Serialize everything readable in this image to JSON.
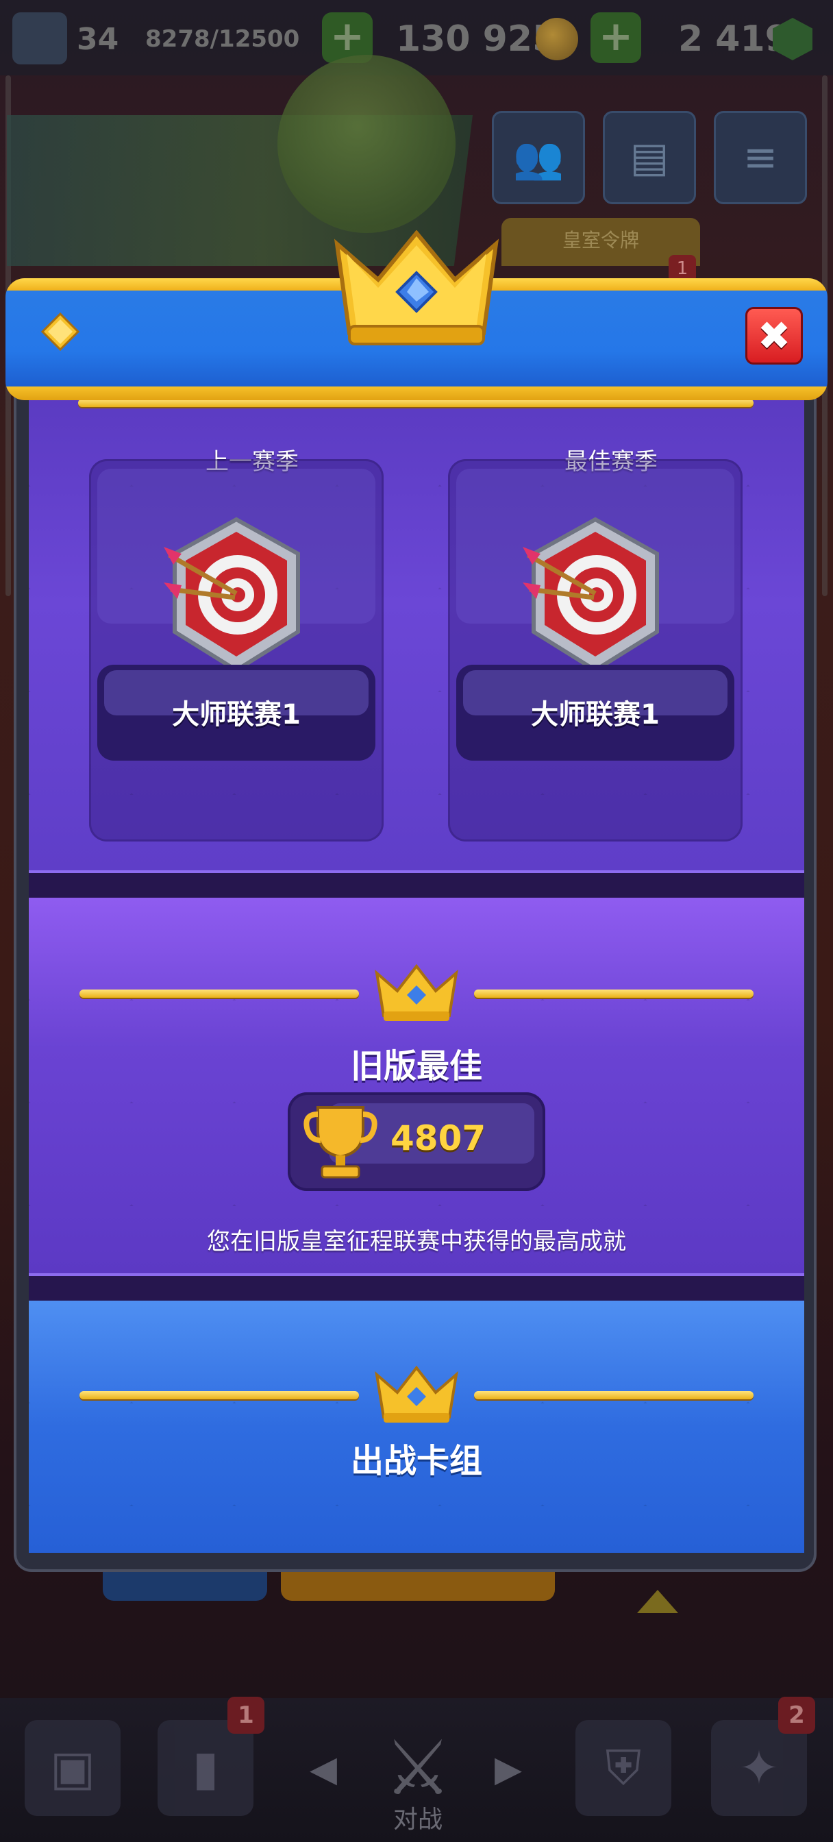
{
  "top_bar": {
    "level": "34",
    "xp": "8278/12500",
    "gold": "130 925",
    "gems": "2 419"
  },
  "background": {
    "royal_pass_tab": "皇室令牌",
    "royal_pass_badge": "1",
    "nav_cards_badge": "1",
    "nav_clan_badge": "2",
    "nav_battle_label": "对战"
  },
  "modal": {
    "close_label": "✖",
    "seasons": [
      {
        "label": "上一赛季",
        "rank": "大师联赛1"
      },
      {
        "label": "最佳赛季",
        "rank": "大师联赛1"
      }
    ],
    "legacy": {
      "title": "旧版最佳",
      "trophies": "4807",
      "description": "您在旧版皇室征程联赛中获得的最高成就"
    },
    "deck": {
      "title": "出战卡组"
    }
  },
  "colors": {
    "accent_gold": "#f0b11b",
    "header_blue": "#2577e8",
    "panel_purple": "#6b47d6",
    "deck_blue": "#2f6ce0",
    "close_red": "#d81d22"
  }
}
